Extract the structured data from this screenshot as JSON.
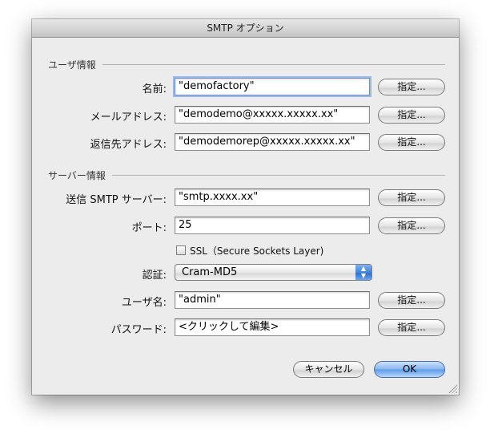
{
  "window": {
    "title": "SMTP オプション"
  },
  "user_section": {
    "heading": "ユーザ情報",
    "name": {
      "label": "名前:",
      "value": "\"demofactory\"",
      "button": "指定..."
    },
    "email": {
      "label": "メールアドレス:",
      "value": "\"demodemo@xxxxx.xxxxx.xx\"",
      "button": "指定..."
    },
    "reply_to": {
      "label": "返信先アドレス:",
      "value": "\"demodemorep@xxxxx.xxxxx.xx\"",
      "button": "指定..."
    }
  },
  "server_section": {
    "heading": "サーバー情報",
    "smtp_server": {
      "label": "送信 SMTP サーバー:",
      "value": "\"smtp.xxxx.xx\"",
      "button": "指定..."
    },
    "port": {
      "label": "ポート:",
      "value": "25",
      "button": "指定..."
    },
    "ssl": {
      "label": "SSL（Secure Sockets Layer)",
      "checked": false
    },
    "auth": {
      "label": "認証:",
      "selected": "Cram-MD5"
    },
    "username": {
      "label": "ユーザ名:",
      "value": "\"admin\"",
      "button": "指定..."
    },
    "password": {
      "label": "パスワード:",
      "value": "<クリックして編集>",
      "button": "指定..."
    }
  },
  "footer": {
    "cancel_label": "キャンセル",
    "ok_label": "OK"
  }
}
